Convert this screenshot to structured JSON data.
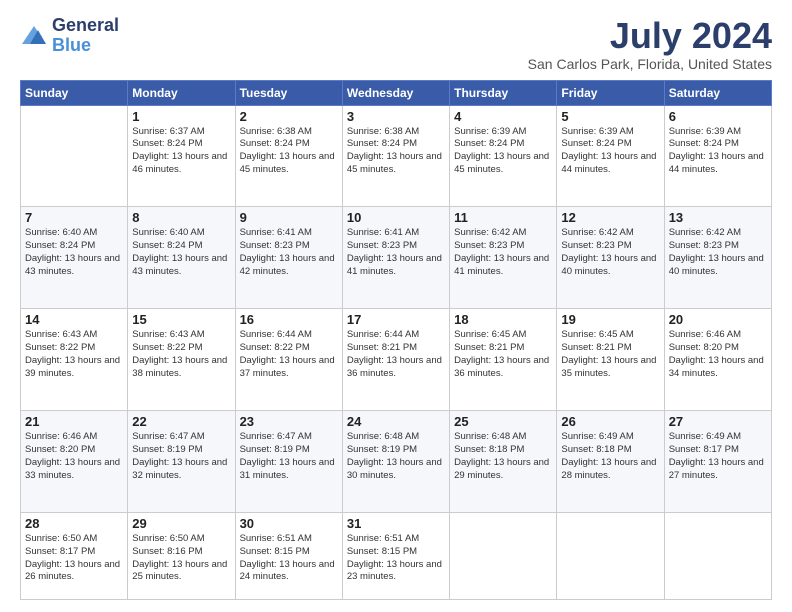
{
  "logo": {
    "general": "General",
    "blue": "Blue"
  },
  "header": {
    "title": "July 2024",
    "subtitle": "San Carlos Park, Florida, United States"
  },
  "weekdays": [
    "Sunday",
    "Monday",
    "Tuesday",
    "Wednesday",
    "Thursday",
    "Friday",
    "Saturday"
  ],
  "weeks": [
    [
      {
        "day": "",
        "sunrise": "",
        "sunset": "",
        "daylight": ""
      },
      {
        "day": "1",
        "sunrise": "Sunrise: 6:37 AM",
        "sunset": "Sunset: 8:24 PM",
        "daylight": "Daylight: 13 hours and 46 minutes."
      },
      {
        "day": "2",
        "sunrise": "Sunrise: 6:38 AM",
        "sunset": "Sunset: 8:24 PM",
        "daylight": "Daylight: 13 hours and 45 minutes."
      },
      {
        "day": "3",
        "sunrise": "Sunrise: 6:38 AM",
        "sunset": "Sunset: 8:24 PM",
        "daylight": "Daylight: 13 hours and 45 minutes."
      },
      {
        "day": "4",
        "sunrise": "Sunrise: 6:39 AM",
        "sunset": "Sunset: 8:24 PM",
        "daylight": "Daylight: 13 hours and 45 minutes."
      },
      {
        "day": "5",
        "sunrise": "Sunrise: 6:39 AM",
        "sunset": "Sunset: 8:24 PM",
        "daylight": "Daylight: 13 hours and 44 minutes."
      },
      {
        "day": "6",
        "sunrise": "Sunrise: 6:39 AM",
        "sunset": "Sunset: 8:24 PM",
        "daylight": "Daylight: 13 hours and 44 minutes."
      }
    ],
    [
      {
        "day": "7",
        "sunrise": "Sunrise: 6:40 AM",
        "sunset": "Sunset: 8:24 PM",
        "daylight": "Daylight: 13 hours and 43 minutes."
      },
      {
        "day": "8",
        "sunrise": "Sunrise: 6:40 AM",
        "sunset": "Sunset: 8:24 PM",
        "daylight": "Daylight: 13 hours and 43 minutes."
      },
      {
        "day": "9",
        "sunrise": "Sunrise: 6:41 AM",
        "sunset": "Sunset: 8:23 PM",
        "daylight": "Daylight: 13 hours and 42 minutes."
      },
      {
        "day": "10",
        "sunrise": "Sunrise: 6:41 AM",
        "sunset": "Sunset: 8:23 PM",
        "daylight": "Daylight: 13 hours and 41 minutes."
      },
      {
        "day": "11",
        "sunrise": "Sunrise: 6:42 AM",
        "sunset": "Sunset: 8:23 PM",
        "daylight": "Daylight: 13 hours and 41 minutes."
      },
      {
        "day": "12",
        "sunrise": "Sunrise: 6:42 AM",
        "sunset": "Sunset: 8:23 PM",
        "daylight": "Daylight: 13 hours and 40 minutes."
      },
      {
        "day": "13",
        "sunrise": "Sunrise: 6:42 AM",
        "sunset": "Sunset: 8:23 PM",
        "daylight": "Daylight: 13 hours and 40 minutes."
      }
    ],
    [
      {
        "day": "14",
        "sunrise": "Sunrise: 6:43 AM",
        "sunset": "Sunset: 8:22 PM",
        "daylight": "Daylight: 13 hours and 39 minutes."
      },
      {
        "day": "15",
        "sunrise": "Sunrise: 6:43 AM",
        "sunset": "Sunset: 8:22 PM",
        "daylight": "Daylight: 13 hours and 38 minutes."
      },
      {
        "day": "16",
        "sunrise": "Sunrise: 6:44 AM",
        "sunset": "Sunset: 8:22 PM",
        "daylight": "Daylight: 13 hours and 37 minutes."
      },
      {
        "day": "17",
        "sunrise": "Sunrise: 6:44 AM",
        "sunset": "Sunset: 8:21 PM",
        "daylight": "Daylight: 13 hours and 36 minutes."
      },
      {
        "day": "18",
        "sunrise": "Sunrise: 6:45 AM",
        "sunset": "Sunset: 8:21 PM",
        "daylight": "Daylight: 13 hours and 36 minutes."
      },
      {
        "day": "19",
        "sunrise": "Sunrise: 6:45 AM",
        "sunset": "Sunset: 8:21 PM",
        "daylight": "Daylight: 13 hours and 35 minutes."
      },
      {
        "day": "20",
        "sunrise": "Sunrise: 6:46 AM",
        "sunset": "Sunset: 8:20 PM",
        "daylight": "Daylight: 13 hours and 34 minutes."
      }
    ],
    [
      {
        "day": "21",
        "sunrise": "Sunrise: 6:46 AM",
        "sunset": "Sunset: 8:20 PM",
        "daylight": "Daylight: 13 hours and 33 minutes."
      },
      {
        "day": "22",
        "sunrise": "Sunrise: 6:47 AM",
        "sunset": "Sunset: 8:19 PM",
        "daylight": "Daylight: 13 hours and 32 minutes."
      },
      {
        "day": "23",
        "sunrise": "Sunrise: 6:47 AM",
        "sunset": "Sunset: 8:19 PM",
        "daylight": "Daylight: 13 hours and 31 minutes."
      },
      {
        "day": "24",
        "sunrise": "Sunrise: 6:48 AM",
        "sunset": "Sunset: 8:19 PM",
        "daylight": "Daylight: 13 hours and 30 minutes."
      },
      {
        "day": "25",
        "sunrise": "Sunrise: 6:48 AM",
        "sunset": "Sunset: 8:18 PM",
        "daylight": "Daylight: 13 hours and 29 minutes."
      },
      {
        "day": "26",
        "sunrise": "Sunrise: 6:49 AM",
        "sunset": "Sunset: 8:18 PM",
        "daylight": "Daylight: 13 hours and 28 minutes."
      },
      {
        "day": "27",
        "sunrise": "Sunrise: 6:49 AM",
        "sunset": "Sunset: 8:17 PM",
        "daylight": "Daylight: 13 hours and 27 minutes."
      }
    ],
    [
      {
        "day": "28",
        "sunrise": "Sunrise: 6:50 AM",
        "sunset": "Sunset: 8:17 PM",
        "daylight": "Daylight: 13 hours and 26 minutes."
      },
      {
        "day": "29",
        "sunrise": "Sunrise: 6:50 AM",
        "sunset": "Sunset: 8:16 PM",
        "daylight": "Daylight: 13 hours and 25 minutes."
      },
      {
        "day": "30",
        "sunrise": "Sunrise: 6:51 AM",
        "sunset": "Sunset: 8:15 PM",
        "daylight": "Daylight: 13 hours and 24 minutes."
      },
      {
        "day": "31",
        "sunrise": "Sunrise: 6:51 AM",
        "sunset": "Sunset: 8:15 PM",
        "daylight": "Daylight: 13 hours and 23 minutes."
      },
      {
        "day": "",
        "sunrise": "",
        "sunset": "",
        "daylight": ""
      },
      {
        "day": "",
        "sunrise": "",
        "sunset": "",
        "daylight": ""
      },
      {
        "day": "",
        "sunrise": "",
        "sunset": "",
        "daylight": ""
      }
    ]
  ]
}
